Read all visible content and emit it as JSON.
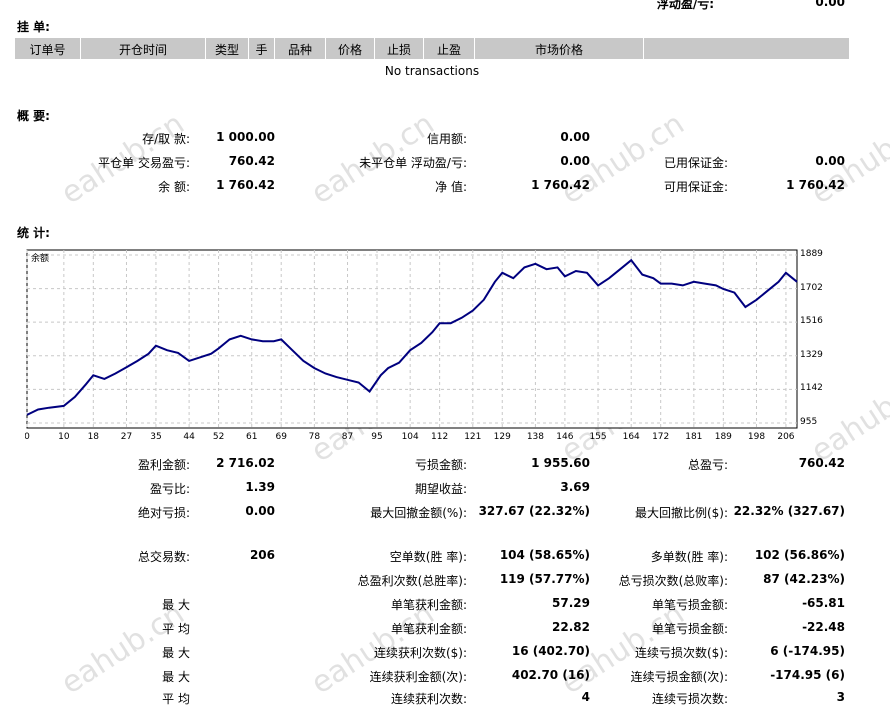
{
  "top_row": {
    "label": "浮动盈/亏:",
    "value": "0.00"
  },
  "orders": {
    "title": "挂 单:",
    "columns": [
      "订单号",
      "开仓时间",
      "类型",
      "手",
      "品种",
      "价格",
      "止损",
      "止盈",
      "市场价格"
    ],
    "empty_text": "No transactions"
  },
  "summary": {
    "title": "概 要:",
    "rows": [
      [
        {
          "label": "存/取 款:",
          "value": "1 000.00"
        },
        {
          "label": "信用额:",
          "value": "0.00"
        },
        {
          "label": "",
          "value": ""
        }
      ],
      [
        {
          "label": "平仓单 交易盈亏:",
          "value": "760.42"
        },
        {
          "label": "未平仓单 浮动盈/亏:",
          "value": "0.00"
        },
        {
          "label": "已用保证金:",
          "value": "0.00"
        }
      ],
      [
        {
          "label": "余 额:",
          "value": "1 760.42"
        },
        {
          "label": "净 值:",
          "value": "1 760.42"
        },
        {
          "label": "可用保证金:",
          "value": "1 760.42"
        }
      ]
    ]
  },
  "stats": {
    "title": "统 计:",
    "rows": [
      [
        {
          "label": "盈利金额:",
          "value": "2 716.02"
        },
        {
          "label": "亏损金额:",
          "value": "1 955.60"
        },
        {
          "label": "总盈亏:",
          "value": "760.42"
        }
      ],
      [
        {
          "label": "盈亏比:",
          "value": "1.39"
        },
        {
          "label": "期望收益:",
          "value": "3.69"
        },
        {
          "label": "",
          "value": ""
        }
      ],
      [
        {
          "label": "绝对亏损:",
          "value": "0.00"
        },
        {
          "label": "最大回撤金额(%):",
          "value": "327.67 (22.32%)"
        },
        {
          "label": "最大回撤比例($):",
          "value": "22.32% (327.67)"
        }
      ]
    ],
    "rows2": [
      [
        {
          "label": "总交易数:",
          "value": "206"
        },
        {
          "label": "空单数(胜 率):",
          "value": "104 (58.65%)"
        },
        {
          "label": "多单数(胜 率):",
          "value": "102 (56.86%)"
        }
      ],
      [
        {
          "label": "",
          "value": ""
        },
        {
          "label": "总盈利次数(总胜率):",
          "value": "119 (57.77%)"
        },
        {
          "label": "总亏损次数(总败率):",
          "value": "87 (42.23%)"
        }
      ],
      [
        {
          "label": "最 大",
          "value": ""
        },
        {
          "label": "单笔获利金额:",
          "value": "57.29"
        },
        {
          "label": "单笔亏损金额:",
          "value": "-65.81"
        }
      ],
      [
        {
          "label": "平 均",
          "value": ""
        },
        {
          "label": "单笔获利金额:",
          "value": "22.82"
        },
        {
          "label": "单笔亏损金额:",
          "value": "-22.48"
        }
      ],
      [
        {
          "label": "最 大",
          "value": ""
        },
        {
          "label": "连续获利次数($):",
          "value": "16 (402.70)"
        },
        {
          "label": "连续亏损次数($):",
          "value": "6 (-174.95)"
        }
      ],
      [
        {
          "label": "最 大",
          "value": ""
        },
        {
          "label": "连续获利金额(次):",
          "value": "402.70 (16)"
        },
        {
          "label": "连续亏损金额(次):",
          "value": "-174.95 (6)"
        }
      ],
      [
        {
          "label": "平 均",
          "value": ""
        },
        {
          "label": "连续获利次数:",
          "value": "4"
        },
        {
          "label": "连续亏损次数:",
          "value": "3"
        }
      ]
    ]
  },
  "watermark": "eahub.cn",
  "chart_data": {
    "type": "line",
    "title": "余额",
    "x_ticks": [
      0,
      10,
      18,
      27,
      35,
      44,
      52,
      61,
      69,
      78,
      87,
      95,
      104,
      112,
      121,
      129,
      138,
      146,
      155,
      164,
      172,
      181,
      189,
      198,
      206
    ],
    "y_ticks": [
      955,
      1142,
      1329,
      1516,
      1702,
      1889
    ],
    "xlim": [
      0,
      209
    ],
    "ylim": [
      955,
      1889
    ],
    "grid": true,
    "line_color": "#00007f",
    "series": [
      {
        "x": [
          0,
          3,
          6,
          10,
          13,
          16,
          18,
          21,
          24,
          27,
          30,
          33,
          35,
          38,
          41,
          44,
          47,
          50,
          52,
          55,
          58,
          61,
          64,
          67,
          69,
          72,
          75,
          78,
          81,
          84,
          87,
          90,
          93,
          96,
          98,
          101,
          104,
          107,
          110,
          112,
          115,
          118,
          121,
          124,
          127,
          129,
          132,
          135,
          138,
          141,
          144,
          146,
          149,
          152,
          155,
          158,
          161,
          164,
          167,
          170,
          172,
          175,
          178,
          181,
          184,
          187,
          189,
          192,
          195,
          198,
          201,
          204,
          206,
          209
        ],
        "y": [
          1000,
          1030,
          1040,
          1050,
          1100,
          1170,
          1220,
          1200,
          1230,
          1265,
          1300,
          1340,
          1385,
          1360,
          1345,
          1300,
          1320,
          1340,
          1370,
          1420,
          1440,
          1420,
          1410,
          1410,
          1420,
          1360,
          1300,
          1260,
          1230,
          1210,
          1195,
          1180,
          1130,
          1220,
          1260,
          1290,
          1360,
          1400,
          1460,
          1510,
          1510,
          1540,
          1580,
          1640,
          1740,
          1790,
          1760,
          1820,
          1840,
          1810,
          1820,
          1770,
          1800,
          1790,
          1720,
          1760,
          1810,
          1860,
          1780,
          1760,
          1730,
          1730,
          1720,
          1740,
          1730,
          1720,
          1700,
          1680,
          1600,
          1640,
          1690,
          1740,
          1790,
          1740
        ]
      }
    ]
  }
}
